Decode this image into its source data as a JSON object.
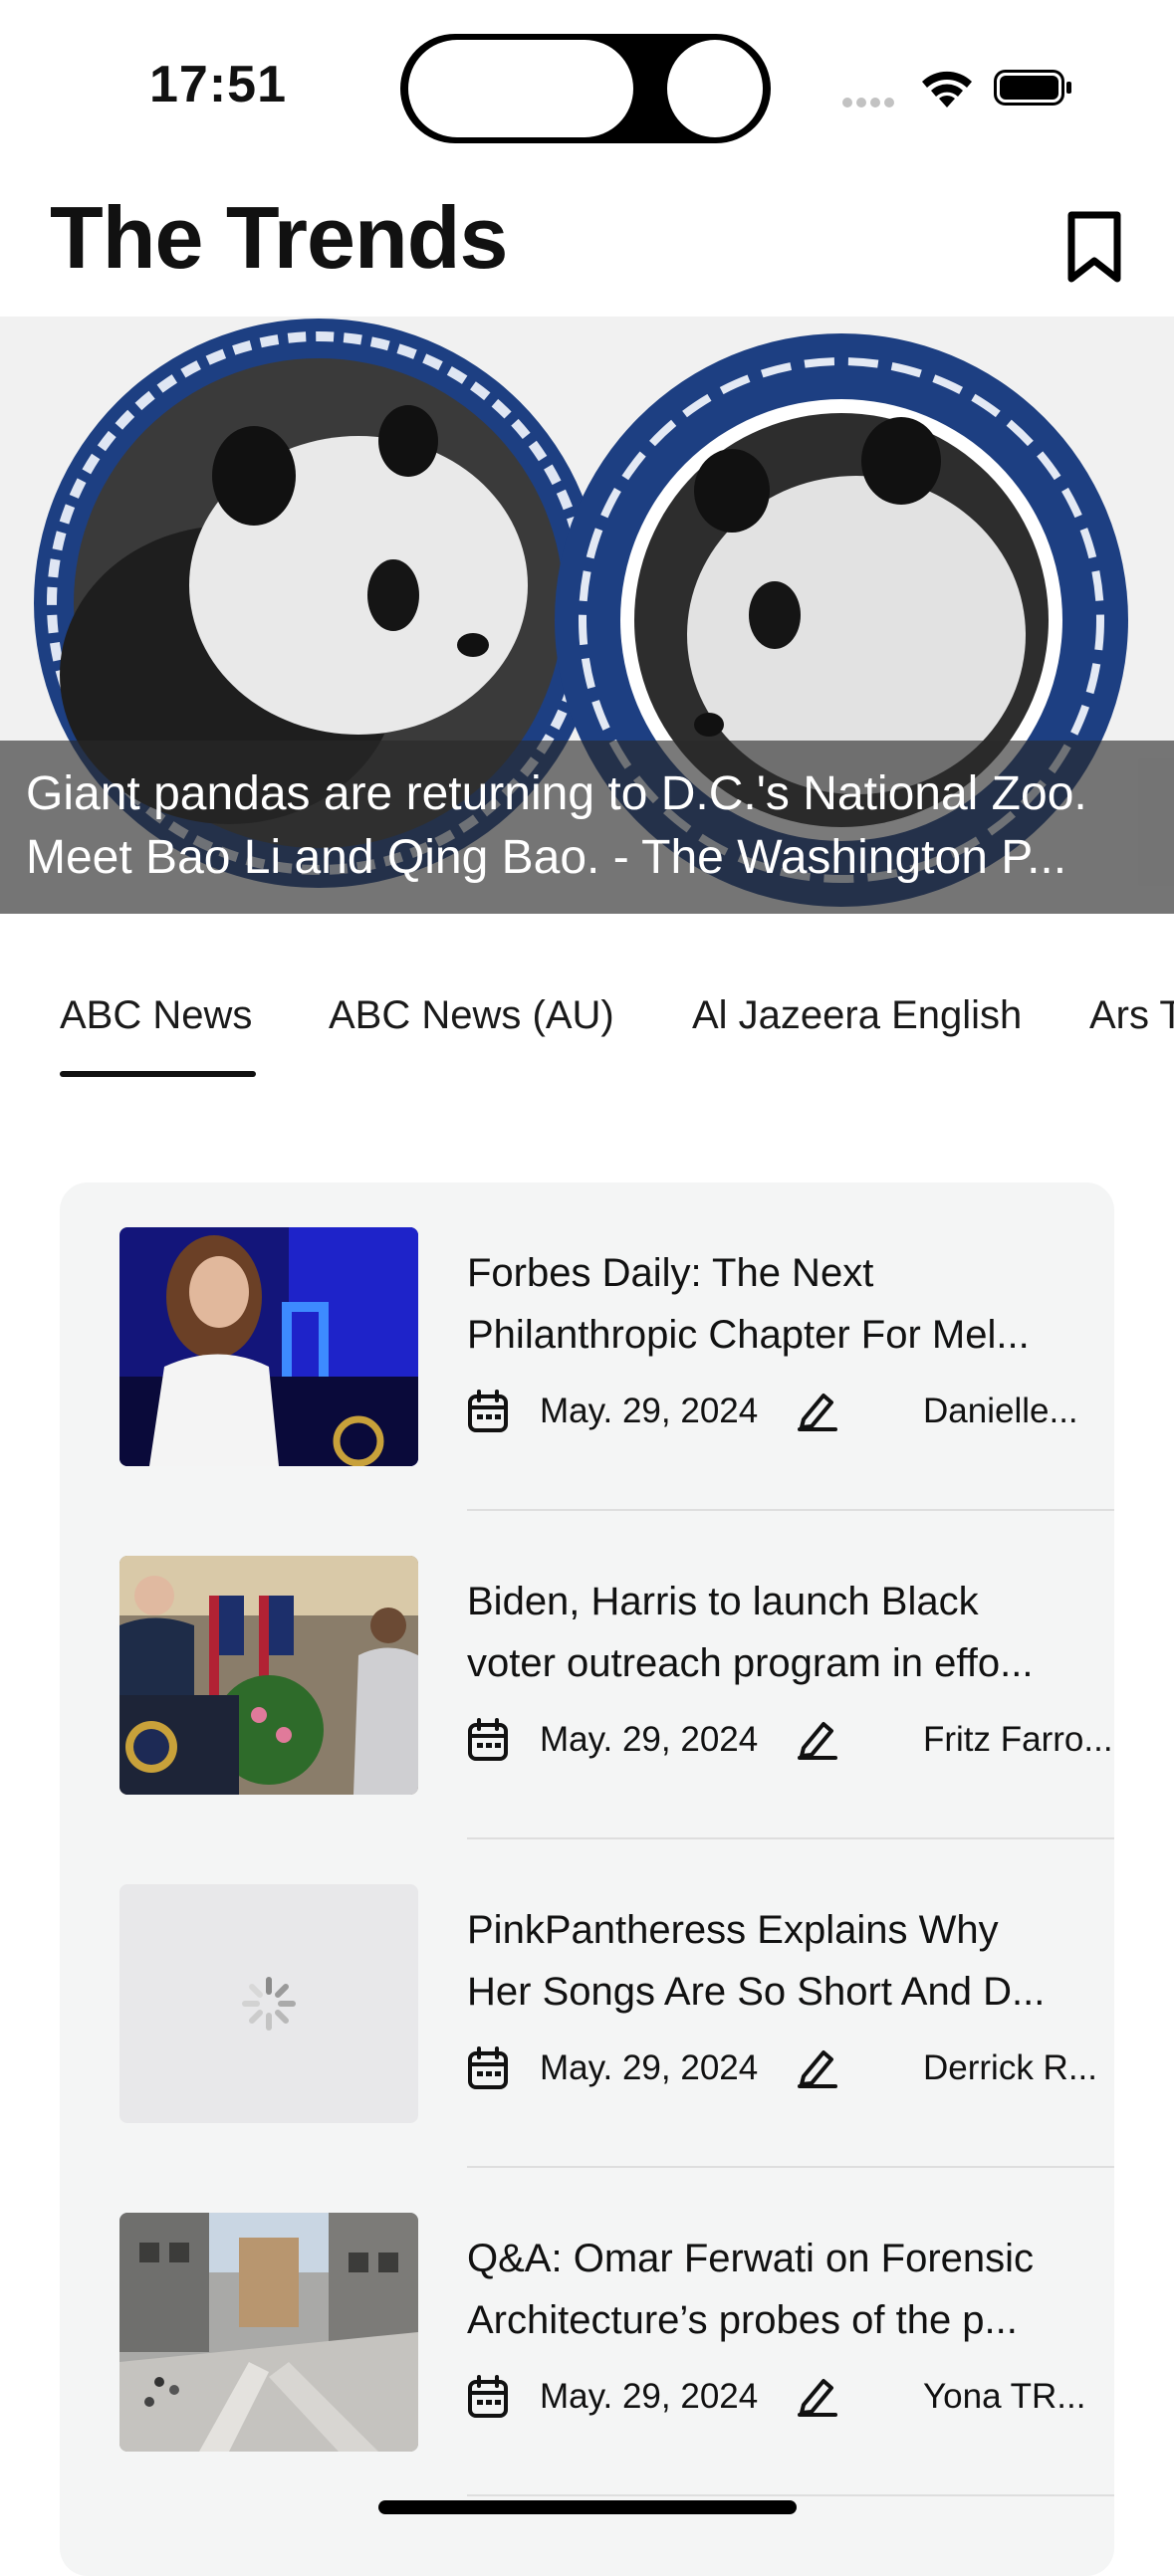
{
  "status": {
    "time": "17:51",
    "signal_icon": "cellular-signal-icon",
    "wifi_icon": "wifi-icon",
    "battery_icon": "battery-icon"
  },
  "header": {
    "title": "The Trends",
    "bookmark_icon": "bookmark-icon"
  },
  "hero": {
    "caption_line1": "Giant pandas are returning to D.C.'s National Zoo.",
    "caption_line2": "Meet Bao Li and Qing Bao. - The Washington P..."
  },
  "tabs": [
    {
      "label": "ABC News",
      "selected": true
    },
    {
      "label": "ABC News (AU)",
      "selected": false
    },
    {
      "label": "Al Jazeera English",
      "selected": false
    },
    {
      "label": "Ars T",
      "selected": false
    }
  ],
  "articles": [
    {
      "title_line1": "Forbes Daily: The Next",
      "title_line2": "Philanthropic Chapter For Mel...",
      "date": "May. 29, 2024",
      "author": "Danielle...",
      "thumbnail": "woman-on-stage"
    },
    {
      "title_line1": "Biden, Harris to launch Black",
      "title_line2": "voter outreach program in effo...",
      "date": "May. 29, 2024",
      "author": "Fritz Farro...",
      "thumbnail": "podium-with-flags"
    },
    {
      "title_line1": "PinkPantheress Explains Why",
      "title_line2": "Her Songs Are So Short And D...",
      "date": "May. 29, 2024",
      "author": "Derrick R...",
      "thumbnail": "loading-spinner"
    },
    {
      "title_line1": "Q&A: Omar Ferwati on Forensic",
      "title_line2": "Architecture’s probes of the p...",
      "date": "May. 29, 2024",
      "author": "Yona TR...",
      "thumbnail": "destroyed-buildings"
    }
  ],
  "colors": {
    "accent": "#111111",
    "card_background": "#f4f5f5",
    "plate_blue": "#1d3f82",
    "caption_overlay": "#282828"
  }
}
